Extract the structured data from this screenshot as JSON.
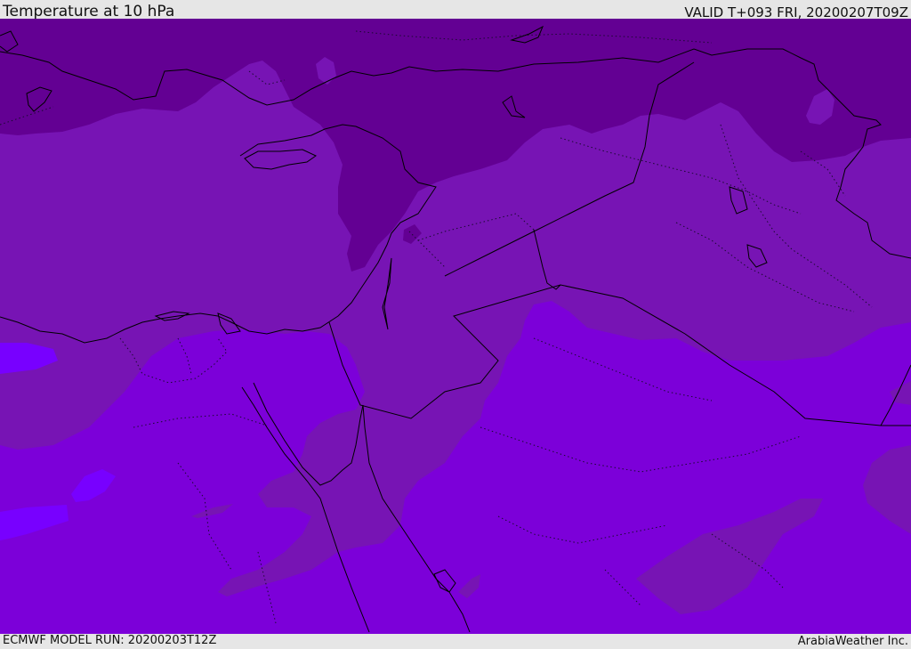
{
  "header": {
    "title": "Temperature at 10 hPa",
    "valid_time": "VALID T+093 FRI, 20200207T09Z"
  },
  "footer": {
    "model_run": "ECMWF MODEL RUN: 20200203T12Z",
    "credit": "ArabiaWeather Inc."
  },
  "map": {
    "field": "temperature",
    "level_hpa": 10,
    "region": "Eastern Mediterranean and Middle East",
    "colors": {
      "dark_band": "#630093",
      "mid_band": "#7714b4",
      "light_band": "#7c00d9",
      "lightest_band": "#7800ff",
      "coastline": "#000000"
    }
  }
}
